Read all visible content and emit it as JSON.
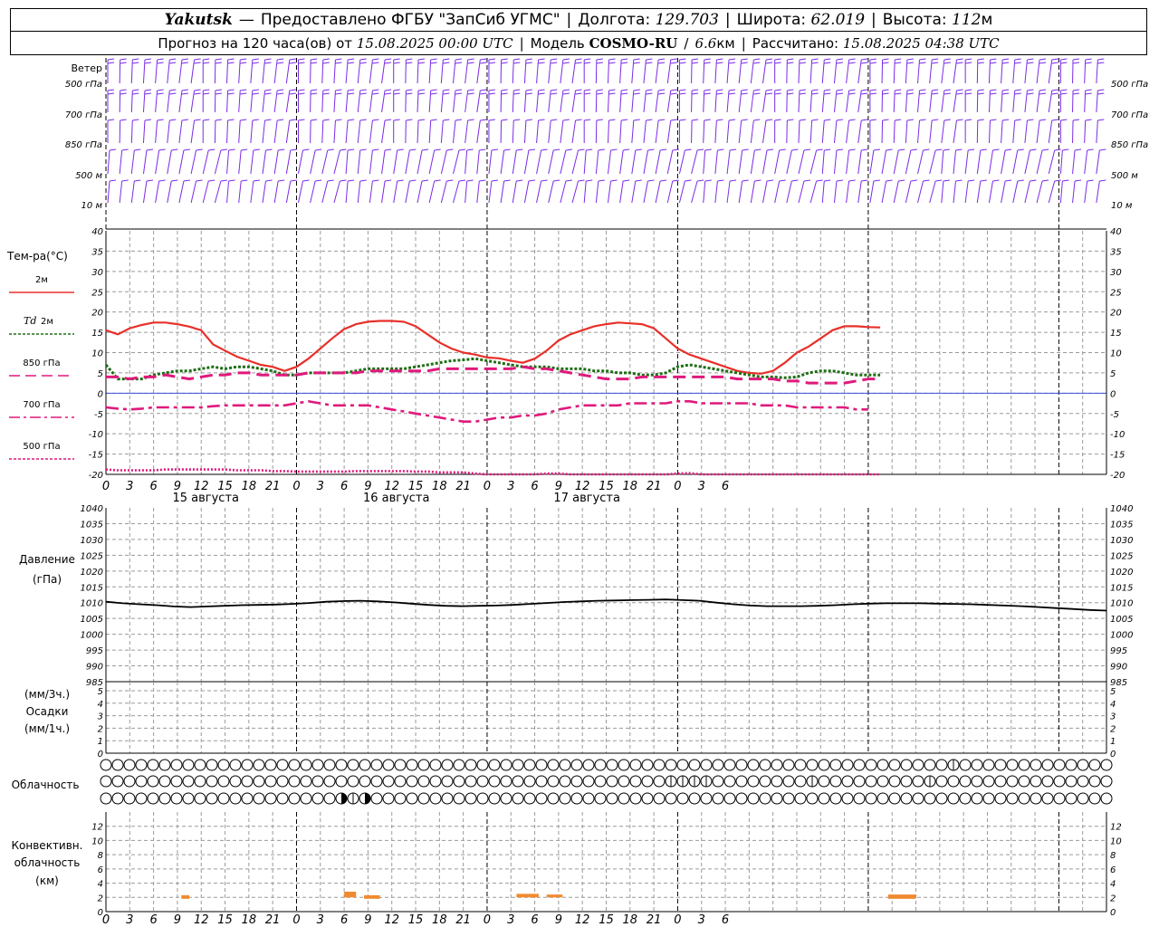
{
  "header": {
    "station": "Yakutsk",
    "dash": "—",
    "provider": "Предоставлено ФГБУ \"ЗапСиб УГМС\"",
    "lon_label": "Долгота:",
    "lon_value": "129.703",
    "lat_label": "Широта:",
    "lat_value": "62.019",
    "alt_label": "Высота:",
    "alt_value": "112",
    "alt_unit": "м",
    "forecast_prefix": "Прогноз на 120 часа(ов) от",
    "forecast_start": "15.08.2025 00:00 UTC",
    "model_label": "Модель",
    "model_name": "COSMO-RU",
    "model_slash": "/",
    "model_res": "6.6",
    "model_res_unit": "км",
    "computed_label": "Рассчитано:",
    "computed_time": "15.08.2025 04:38 UTC"
  },
  "colors": {
    "wind": "#7a2be6",
    "t2m": "#e8302a",
    "td2m": "#1e6e14",
    "t850": "#e0197c",
    "t700": "#e0197c",
    "t500": "#e0197c",
    "pressure": "#000000",
    "zero_line": "#3b4fe0",
    "convective": "#f08a30",
    "grid": "#9a9a9a"
  },
  "wind_panel": {
    "title": "Ветер",
    "levels": [
      "500 гПа",
      "700 гПа",
      "850 гПа",
      "500 м",
      "10  м"
    ]
  },
  "temp_panel": {
    "title": "Тем-ра(°C)",
    "legend": [
      {
        "label": "2м",
        "style": "solid",
        "series": "t2m"
      },
      {
        "label_it": "Td",
        "label": " 2м",
        "style": "dotted",
        "series": "td2m"
      },
      {
        "label": "850 гПа",
        "style": "dashed",
        "series": "t850"
      },
      {
        "label": "700 гПа",
        "style": "dashdot",
        "series": "t700"
      },
      {
        "label": "500 гПа",
        "style": "dotted",
        "series": "t500"
      }
    ],
    "yticks": [
      "40",
      "35",
      "30",
      "25",
      "20",
      "15",
      "10",
      "5",
      "0",
      "-5",
      "-10",
      "-15",
      "-20"
    ],
    "ylim": [
      -20,
      40
    ]
  },
  "x_hour_ticks": [
    "0",
    "3",
    "6",
    "9",
    "12",
    "15",
    "18",
    "21",
    "0",
    "3",
    "6",
    "9",
    "12",
    "15",
    "18",
    "21",
    "0",
    "3",
    "6",
    "9",
    "12",
    "15",
    "18",
    "21",
    "0",
    "3",
    "6"
  ],
  "dates": [
    "15 августа",
    "16 августа",
    "17 августа"
  ],
  "pressure_panel": {
    "title": "Давление",
    "unit": "(гПа)",
    "yticks": [
      "1040",
      "1035",
      "1030",
      "1025",
      "1020",
      "1015",
      "1010",
      "1005",
      "1000",
      "995",
      "990",
      "985"
    ]
  },
  "precip_panel": {
    "unit3": "(мм/3ч.)",
    "title": "Осадки",
    "unit1": "(мм/1ч.)",
    "yticks": [
      "5",
      "4",
      "3",
      "2",
      "1",
      "0"
    ]
  },
  "cloud_panel": {
    "title": "Облачность",
    "rows": [
      "000000000000000000000000000000000000000000000000000000000000000000000000200000000000000000",
      "000000000000000000000000000000000000000000000000222200000000200000000020000000000000000000000000000444",
      "000000000000000000003230000000000000000000000000000000000000000000000000000000000000002000000000000044434434434"
    ]
  },
  "conv_panel": {
    "title1": "Конвективн.",
    "title2": "облачность",
    "unit": "(км)",
    "yticks": [
      "12",
      "10",
      "8",
      "6",
      "4",
      "2",
      "0"
    ]
  },
  "chart_data": [
    {
      "type": "barbs",
      "name": "wind",
      "levels": [
        "500 гПа",
        "700 гПа",
        "850 гПа",
        "500 м",
        "10  м"
      ],
      "hours_range": [
        0,
        126
      ],
      "step_h": 1.5
    },
    {
      "type": "line",
      "title": "Тем-ра(°C)",
      "x_hours": [
        0,
        1.5,
        3,
        4.5,
        6,
        7.5,
        9,
        10.5,
        12,
        13.5,
        15,
        16.5,
        18,
        19.5,
        21,
        22.5,
        24,
        25.5,
        27,
        28.5,
        30,
        31.5,
        33,
        34.5,
        36,
        37.5,
        39,
        40.5,
        42,
        43.5,
        45,
        46.5,
        48,
        49.5,
        51,
        52.5,
        54,
        55.5,
        57,
        58.5,
        60,
        61.5,
        63,
        64.5,
        66,
        67.5,
        69,
        70.5,
        72,
        73.5,
        75,
        76.5,
        78,
        79.5,
        81,
        82.5,
        84,
        85.5,
        87,
        88.5,
        90,
        91.5,
        93,
        94.5,
        96,
        97.5,
        99,
        100.5,
        102,
        103.5,
        105,
        106.5,
        108,
        109.5,
        111,
        112.5,
        114,
        115.5,
        117,
        118.5,
        120,
        121.5,
        123,
        124.5,
        126
      ],
      "ylim": [
        -20,
        40
      ],
      "series": [
        {
          "name": "2м",
          "key": "t2m",
          "values": [
            15.5,
            14.5,
            16,
            16.8,
            17.4,
            17.4,
            17,
            16.4,
            15.5,
            12,
            10.5,
            9,
            8,
            7,
            6.5,
            5.5,
            6.5,
            8.5,
            11,
            13.5,
            15.8,
            17,
            17.6,
            17.8,
            17.8,
            17.6,
            16.5,
            14.5,
            12.5,
            11,
            10,
            9.5,
            8.8,
            8.6,
            8,
            7.5,
            8.5,
            10.5,
            13,
            14.5,
            15.5,
            16.5,
            17,
            17.4,
            17.2,
            17,
            16,
            13.5,
            11,
            9.5,
            8.5,
            7.5,
            6.5,
            5.5,
            5,
            4.8,
            5.5,
            7.5,
            10,
            11.5,
            13.5,
            15.5,
            16.5,
            16.5,
            16.3,
            16.2
          ]
        },
        {
          "name": "Td 2м",
          "key": "td2m",
          "values": [
            7,
            3.5,
            3.5,
            3.5,
            4.5,
            5,
            5.5,
            5.5,
            6,
            6.5,
            6,
            6.5,
            6.5,
            6,
            5.5,
            4.5,
            4.5,
            5,
            5,
            5,
            5,
            5.5,
            6,
            6,
            6,
            6,
            6.5,
            7,
            7.5,
            8,
            8.2,
            8.5,
            8,
            7.5,
            7,
            6.5,
            6.5,
            6.5,
            6,
            6,
            6,
            5.5,
            5.5,
            5,
            5,
            4.5,
            4.5,
            5,
            6.5,
            7,
            6.5,
            6,
            5.5,
            5,
            4.5,
            4,
            4,
            3.8,
            4,
            5,
            5.5,
            5.5,
            5,
            4.5,
            4.5,
            4.5
          ]
        },
        {
          "name": "850 гПа",
          "key": "t850",
          "values": [
            4,
            4,
            3.5,
            4,
            4,
            4.5,
            4,
            3.5,
            4,
            4.5,
            4.5,
            5,
            5,
            4.5,
            4.5,
            4.5,
            4.5,
            5,
            5,
            5,
            5,
            5,
            5.5,
            5.5,
            5.5,
            5.5,
            5.5,
            5.5,
            6,
            6,
            6,
            6,
            6,
            6,
            6,
            6.5,
            6,
            6,
            5.5,
            5,
            4.5,
            4,
            3.5,
            3.5,
            3.5,
            4,
            4,
            4,
            4,
            4,
            4,
            4,
            4,
            3.5,
            3.5,
            3.5,
            3.5,
            3,
            3,
            2.5,
            2.5,
            2.5,
            2.5,
            3,
            3.5,
            3.5
          ]
        },
        {
          "name": "700 гПа",
          "key": "t700",
          "values": [
            -3.5,
            -3.8,
            -4,
            -3.8,
            -3.5,
            -3.5,
            -3.5,
            -3.5,
            -3.5,
            -3.2,
            -3,
            -3,
            -3,
            -3,
            -3,
            -3,
            -2.5,
            -2,
            -2.5,
            -3,
            -3,
            -3,
            -3,
            -3.5,
            -4,
            -4.5,
            -5,
            -5.5,
            -6,
            -6.5,
            -7,
            -7,
            -6.5,
            -6,
            -6,
            -5.5,
            -5.5,
            -5,
            -4,
            -3.5,
            -3,
            -3,
            -3,
            -3,
            -2.5,
            -2.5,
            -2.5,
            -2.5,
            -2,
            -2,
            -2.5,
            -2.5,
            -2.5,
            -2.5,
            -2.5,
            -3,
            -3,
            -3,
            -3.5,
            -3.5,
            -3.5,
            -3.5,
            -3.5,
            -4,
            -4
          ]
        },
        {
          "name": "500 гПа",
          "key": "t500",
          "values": [
            -18.8,
            -19,
            -19,
            -19,
            -19,
            -18.8,
            -18.8,
            -18.8,
            -18.8,
            -18.8,
            -18.8,
            -19,
            -19,
            -19,
            -19.2,
            -19.2,
            -19.3,
            -19.3,
            -19.3,
            -19.3,
            -19.3,
            -19.2,
            -19.2,
            -19.2,
            -19.2,
            -19.2,
            -19.3,
            -19.3,
            -19.5,
            -19.5,
            -19.5,
            -19.8,
            -20.2,
            -20.5,
            -20.5,
            -20.5,
            -20,
            -19.8,
            -19.8,
            -20.5,
            -21,
            -21,
            -21,
            -21,
            -21,
            -20.5,
            -20.5,
            -20,
            -19.8,
            -19.7,
            -20,
            -20.5,
            -21,
            -21,
            -21,
            -21,
            -21,
            -21,
            -21,
            -21,
            -21,
            -21,
            -21,
            -21,
            -21,
            -21
          ]
        }
      ]
    },
    {
      "type": "line",
      "title": "Давление",
      "ylabel": "(гПа)",
      "ylim": [
        985,
        1040
      ],
      "series": [
        {
          "name": "Давление",
          "key": "pressure",
          "values": [
            1010.3,
            1009.8,
            1009.5,
            1009.2,
            1008.8,
            1008.6,
            1008.8,
            1009,
            1009.2,
            1009.3,
            1009.4,
            1009.6,
            1009.9,
            1010.3,
            1010.5,
            1010.6,
            1010.4,
            1010.1,
            1009.7,
            1009.3,
            1009,
            1008.9,
            1009,
            1009.1,
            1009.3,
            1009.6,
            1009.9,
            1010.2,
            1010.4,
            1010.6,
            1010.7,
            1010.8,
            1010.9,
            1011,
            1010.8,
            1010.6,
            1010,
            1009.5,
            1009.1,
            1008.9,
            1008.9,
            1008.9,
            1009,
            1009.2,
            1009.5,
            1009.7,
            1009.8,
            1009.8,
            1009.8,
            1009.7,
            1009.6,
            1009.5,
            1009.3,
            1009.1,
            1008.9,
            1008.6,
            1008.3,
            1008,
            1007.7,
            1007.5
          ]
        }
      ]
    },
    {
      "type": "bar",
      "title": "Осадки",
      "ylim": [
        0,
        5
      ],
      "values": []
    },
    {
      "type": "bar",
      "title": "Конвективн. облачность",
      "ylabel": "(км)",
      "ylim": [
        0,
        13
      ],
      "bars": [
        {
          "x_start": 9.5,
          "x_end": 10.5,
          "bottom": 1.8,
          "top": 2.3
        },
        {
          "x_start": 6,
          "x_end": 7.5,
          "bottom": 2,
          "top": 2.8
        },
        {
          "x_start": 8.5,
          "x_end": 10.5,
          "bottom": 1.8,
          "top": 2.3
        },
        {
          "x_start": 3.7,
          "x_end": 6.5,
          "bottom": 2,
          "top": 2.5
        },
        {
          "x_start": 7.5,
          "x_end": 9.5,
          "bottom": 2,
          "top": 2.4
        },
        {
          "x_start": 2.5,
          "x_end": 6,
          "bottom": 1.8,
          "top": 2.4
        }
      ]
    }
  ]
}
